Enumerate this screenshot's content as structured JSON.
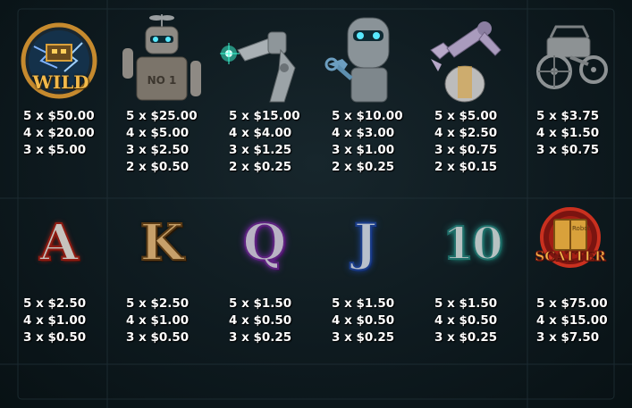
{
  "paytable": {
    "row1": [
      {
        "symbol": "wild-robot-lightning",
        "label": "WILD",
        "pays": [
          "5 x $50.00",
          "4 x $20.00",
          "3 x $5.00"
        ]
      },
      {
        "symbol": "robot-no1",
        "label": "NO 1",
        "pays": [
          "5 x $25.00",
          "4 x $5.00",
          "3 x $2.50",
          "2 x $0.50"
        ]
      },
      {
        "symbol": "robot-arm-laser",
        "pays": [
          "5 x $15.00",
          "4 x $4.00",
          "3 x $1.25",
          "2 x $0.25"
        ]
      },
      {
        "symbol": "robot-head-wrench",
        "pays": [
          "5 x $10.00",
          "4 x $3.00",
          "3 x $1.00",
          "2 x $0.25"
        ]
      },
      {
        "symbol": "robot-claw-arm",
        "pays": [
          "5 x $5.00",
          "4 x $2.50",
          "3 x $0.75",
          "2 x $0.15"
        ]
      },
      {
        "symbol": "robot-cart",
        "pays": [
          "5 x $3.75",
          "4 x $1.50",
          "3 x $0.75"
        ]
      }
    ],
    "row2": [
      {
        "symbol": "letter-a",
        "label": "A",
        "pays": [
          "5 x $2.50",
          "4 x $1.00",
          "3 x $0.50"
        ]
      },
      {
        "symbol": "letter-k",
        "label": "K",
        "pays": [
          "5 x $2.50",
          "4 x $1.00",
          "3 x $0.50"
        ]
      },
      {
        "symbol": "letter-q",
        "label": "Q",
        "pays": [
          "5 x $1.50",
          "4 x $0.50",
          "3 x $0.25"
        ]
      },
      {
        "symbol": "letter-j",
        "label": "J",
        "pays": [
          "5 x $1.50",
          "4 x $0.50",
          "3 x $0.25"
        ]
      },
      {
        "symbol": "number-10",
        "label": "10",
        "pays": [
          "5 x $1.50",
          "4 x $0.50",
          "3 x $0.25"
        ]
      },
      {
        "symbol": "scatter-book",
        "label": "SCATTER",
        "sublabel": "Robot",
        "pays": [
          "5 x $75.00",
          "4 x $15.00",
          "3 x $7.50"
        ]
      }
    ]
  },
  "colors": {
    "text": "#ffffff",
    "background": "#0e1a1f",
    "gold": "#d9a13b",
    "metal": "#9aa3a8",
    "laser": "#3cffd8"
  }
}
